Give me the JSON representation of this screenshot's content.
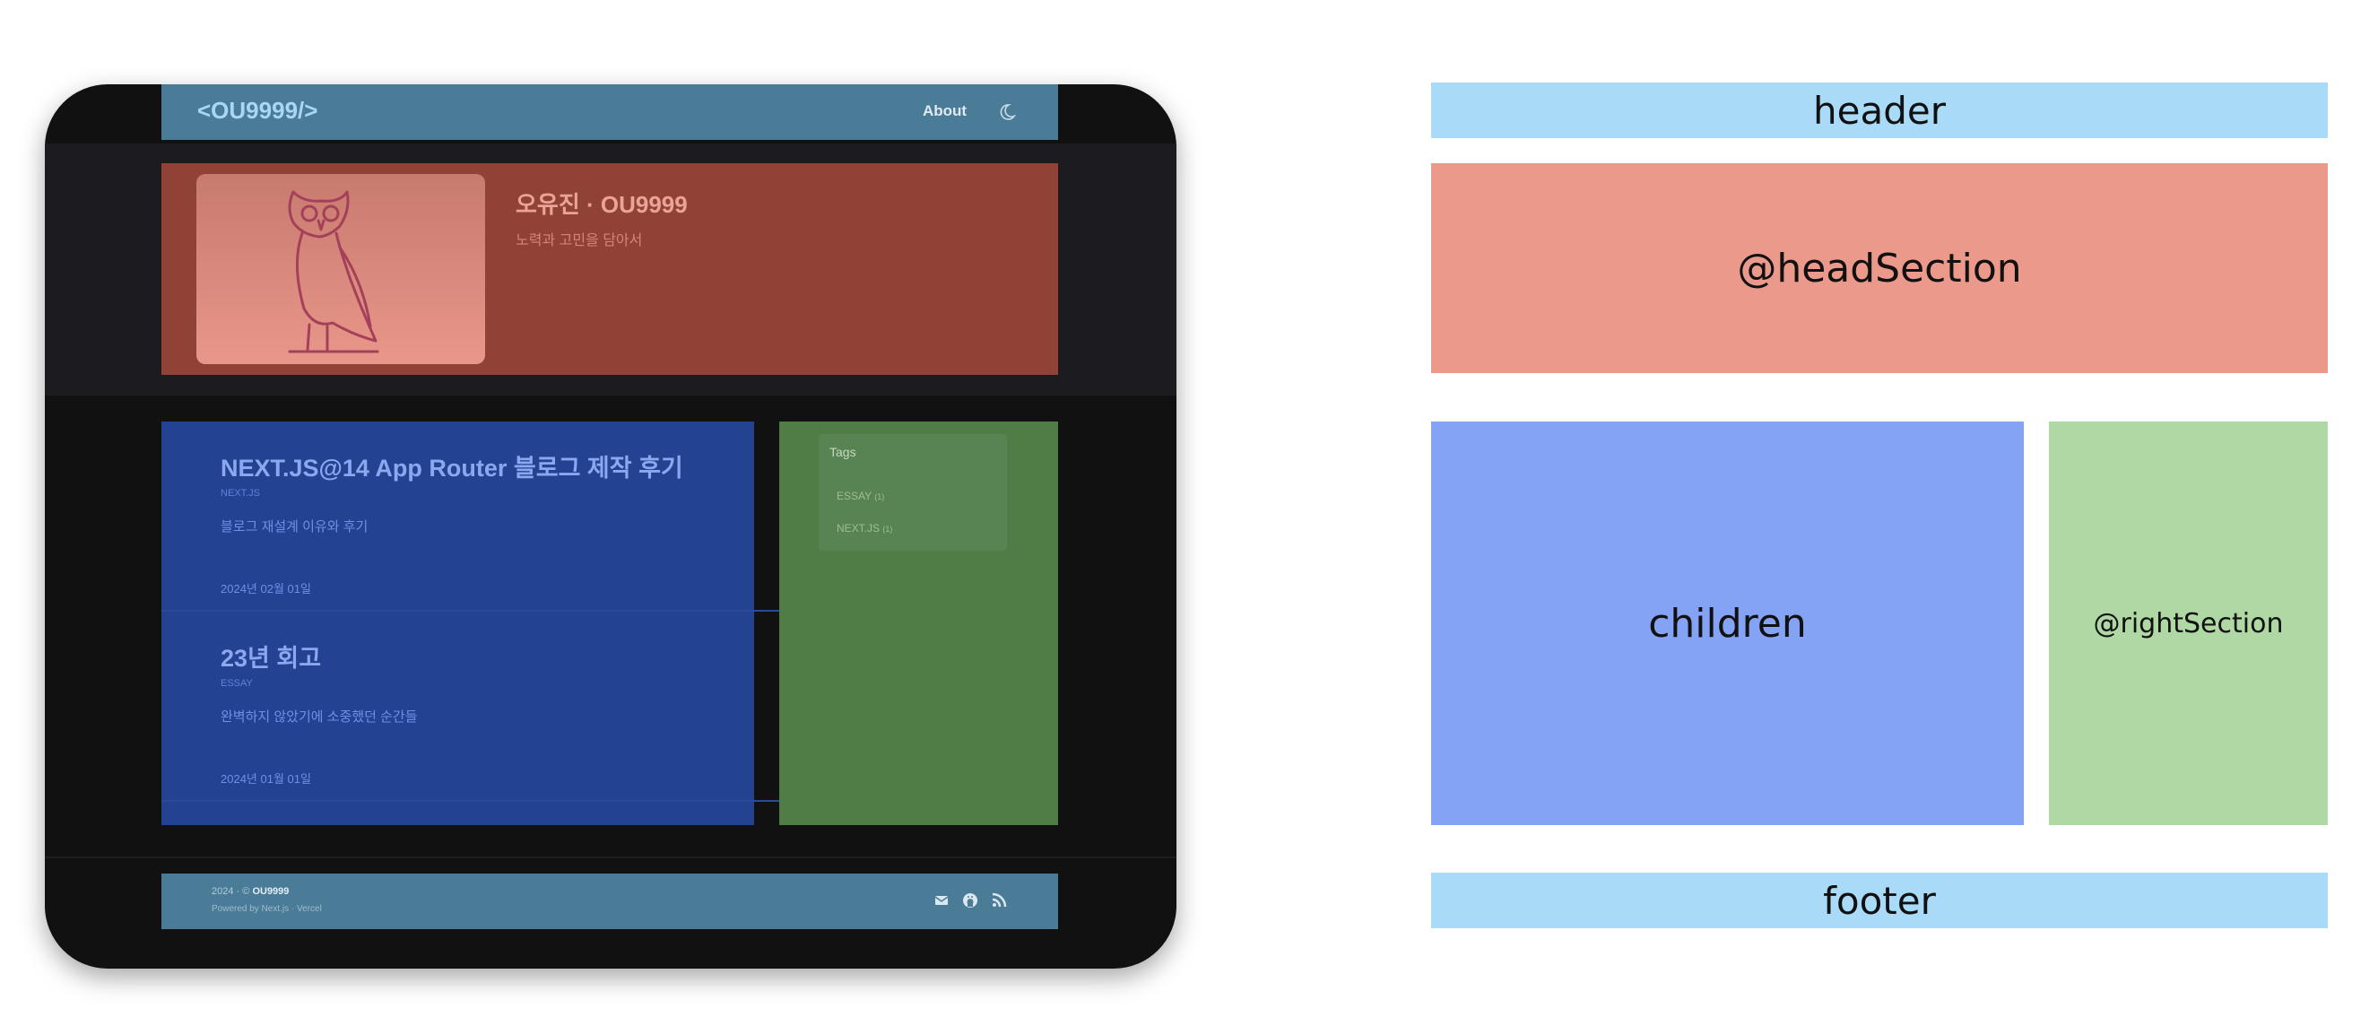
{
  "mockup": {
    "header": {
      "logo": "<OU9999/>",
      "nav_about": "About",
      "theme_icon": "moon-icon"
    },
    "head_section": {
      "owl_icon": "owl-icon",
      "name": "오유진 · OU9999",
      "subtitle": "노력과 고민을 담아서"
    },
    "posts": [
      {
        "title": "NEXT.JS@14 App Router 블로그 제작 후기",
        "tag": "NEXT.JS",
        "description": "블로그 재설계 이유와 후기",
        "date": "2024년 02월 01일"
      },
      {
        "title": "23년 회고",
        "tag": "ESSAY",
        "description": "완벽하지 않았기에 소중했던 순간들",
        "date": "2024년 01월 01일"
      }
    ],
    "tags": {
      "title": "Tags",
      "items": [
        {
          "label": "ESSAY",
          "count": "(1)"
        },
        {
          "label": "NEXT.JS",
          "count": "(1)"
        }
      ]
    },
    "footer": {
      "year": "2024 ·",
      "copyright_prefix": "©",
      "owner": "OU9999",
      "powered": "Powered by Next.js · Vercel",
      "icons": [
        "mail-icon",
        "github-icon",
        "rss-icon"
      ]
    }
  },
  "legend": {
    "header": "header",
    "head_section": "@headSection",
    "children": "children",
    "right_section": "@rightSection",
    "footer": "footer"
  },
  "colors": {
    "header": "#a9daf7",
    "head_section": "#ea998b",
    "children": "#85a3f4",
    "right_section": "#afd8a5",
    "footer": "#a9daf7",
    "device": "#111111"
  }
}
